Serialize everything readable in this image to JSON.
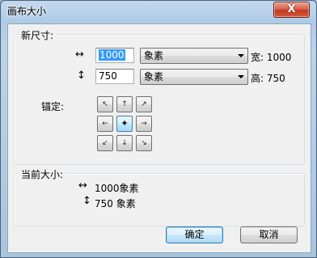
{
  "window": {
    "title": "画布大小",
    "close_label": "X"
  },
  "new_size": {
    "group_title": "新尺寸:",
    "width_arrow": "↔",
    "width_value": "1000",
    "width_unit": "象素",
    "width_label": "宽: 1000",
    "height_arrow": "↕",
    "height_value": "750",
    "height_unit": "象素",
    "height_label": "高: 750",
    "anchor_label": "锚定:",
    "anchor_glyphs": [
      "↖",
      "↑",
      "↗",
      "←",
      "✦",
      "→",
      "↙",
      "↓",
      "↘"
    ],
    "anchor_selected": "center"
  },
  "current_size": {
    "group_title": "当前大小:",
    "width_arrow": "↔",
    "width_text": "1000象素",
    "height_arrow": "↕",
    "height_text": "750  象素"
  },
  "buttons": {
    "ok": "确定",
    "cancel": "取消"
  }
}
